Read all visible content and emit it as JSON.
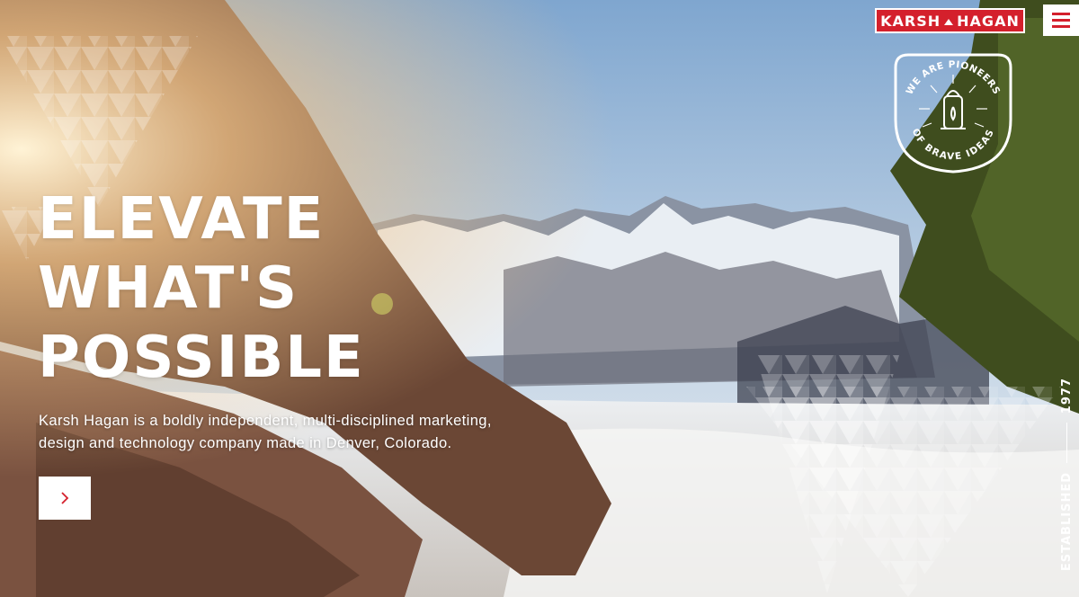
{
  "brand": {
    "logo_left": "KARSH",
    "logo_right": "HAGAN",
    "accent_color": "#d4202c"
  },
  "nav": {
    "menu_icon": "hamburger-icon"
  },
  "badge": {
    "top_text": "WE ARE PIONEERS",
    "bottom_text": "OF BRAVE IDEAS",
    "icon": "lantern-icon"
  },
  "hero": {
    "headline": [
      "ELEVATE",
      "WHAT'S",
      "POSSIBLE"
    ],
    "description_line1": "Karsh Hagan is a boldly independent, multi-disciplined marketing,",
    "description_line2": "design and technology company made in Denver, Colorado.",
    "cta_icon": "chevron-right-icon"
  },
  "side": {
    "year": "1977",
    "label": "ESTABLISHED"
  }
}
